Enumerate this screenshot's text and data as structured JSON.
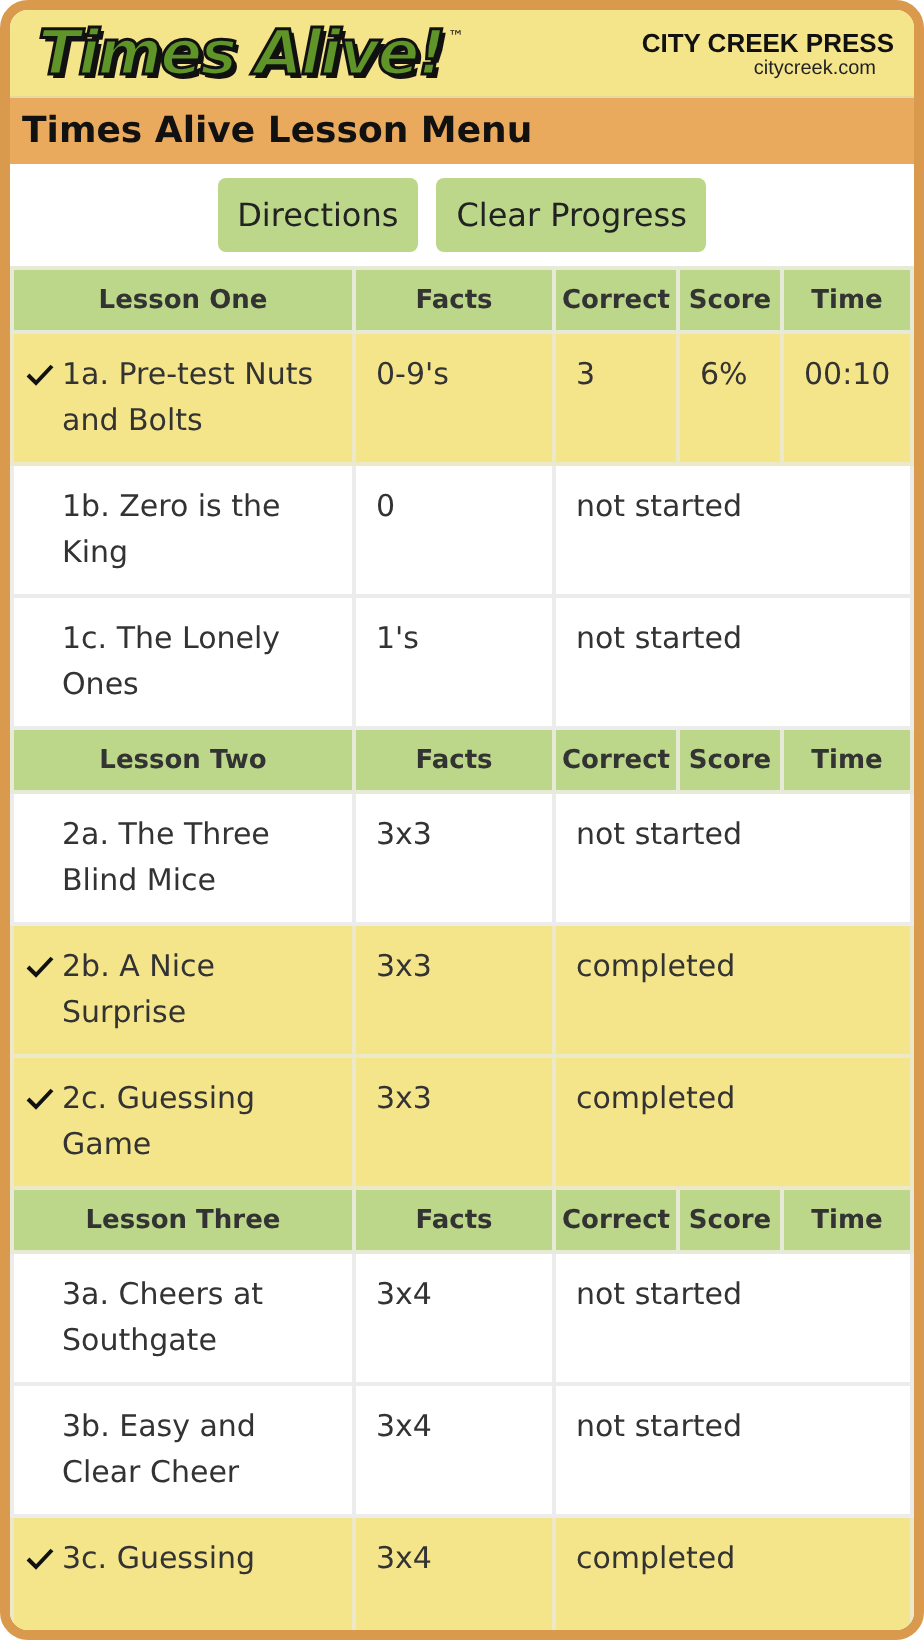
{
  "header": {
    "logo": "Times Alive!",
    "trademark": "™",
    "publisher": "CITY CREEK PRESS",
    "website": "citycreek.com"
  },
  "title": "Times Alive Lesson Menu",
  "buttons": [
    "Directions",
    "Clear Progress"
  ],
  "lessons": [
    {
      "columns": [
        "Lesson One",
        "Facts",
        "Correct",
        "Score",
        "Time"
      ],
      "rows": [
        {
          "kind": "result",
          "checked": true,
          "name": "1a. Pre-test Nuts and Bolts",
          "facts": "0-9's",
          "correct": "3",
          "score": "6%",
          "time": "00:10"
        },
        {
          "kind": "status",
          "checked": false,
          "name": "1b. Zero is the King",
          "facts": "0",
          "status": "not started"
        },
        {
          "kind": "status",
          "checked": false,
          "name": "1c. The Lonely Ones",
          "facts": "1's",
          "status": "not started"
        }
      ]
    },
    {
      "columns": [
        "Lesson Two",
        "Facts",
        "Correct",
        "Score",
        "Time"
      ],
      "rows": [
        {
          "kind": "status",
          "checked": false,
          "name": "2a. The Three Blind Mice",
          "facts": "3x3",
          "status": "not started"
        },
        {
          "kind": "status",
          "checked": true,
          "name": "2b. A Nice Surprise",
          "facts": "3x3",
          "status": "completed"
        },
        {
          "kind": "status",
          "checked": true,
          "name": "2c. Guessing Game",
          "facts": "3x3",
          "status": "completed"
        }
      ]
    },
    {
      "columns": [
        "Lesson Three",
        "Facts",
        "Correct",
        "Score",
        "Time"
      ],
      "rows": [
        {
          "kind": "status",
          "checked": false,
          "name": "3a. Cheers at Southgate",
          "facts": "3x4",
          "status": "not started"
        },
        {
          "kind": "status",
          "checked": false,
          "name": "3b. Easy and Clear Cheer",
          "facts": "3x4",
          "status": "not started"
        },
        {
          "kind": "status",
          "checked": true,
          "name": "3c. Guessing",
          "facts": "3x4",
          "status": "completed"
        }
      ]
    }
  ]
}
